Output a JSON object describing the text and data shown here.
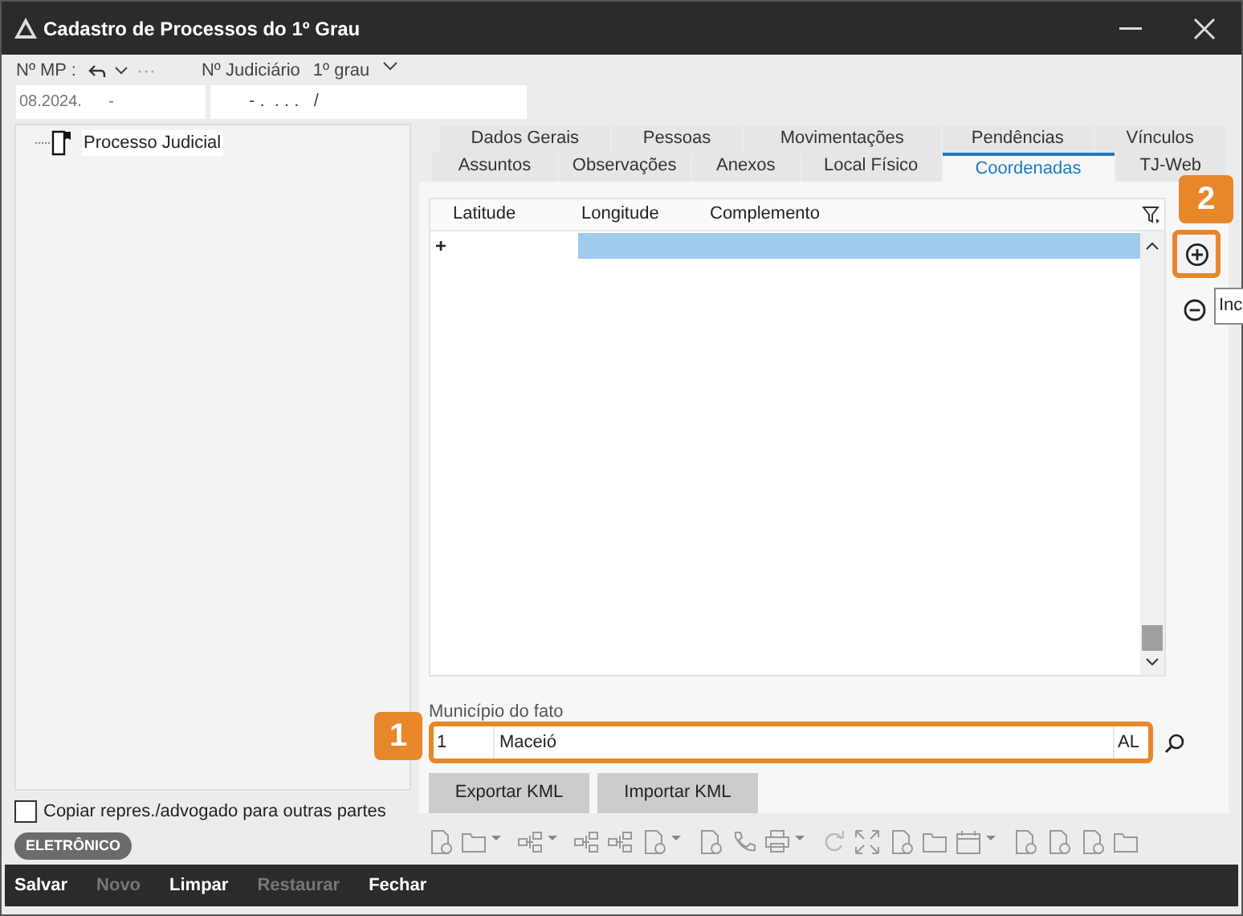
{
  "window": {
    "title": "Cadastro de Processos do 1º Grau"
  },
  "header": {
    "mp_label": "Nº MP :",
    "mp_value": "08.2024.      -",
    "judiciario_label": "Nº Judiciário",
    "grau": "1º grau",
    "judiciario_value": "- .  . . .   /"
  },
  "tree": [
    {
      "label": "Processo Judicial",
      "selected": false
    }
  ],
  "tabs_row_1": [
    {
      "label": "Dados Gerais",
      "selected": false
    },
    {
      "label": "Pessoas",
      "selected": false
    },
    {
      "label": "Movimentações",
      "selected": false
    },
    {
      "label": "Pendências",
      "selected": false
    },
    {
      "label": "Vínculos",
      "selected": false
    }
  ],
  "tabs_row_2": [
    {
      "label": "Assuntos",
      "selected": false
    },
    {
      "label": "Observações",
      "selected": false
    },
    {
      "label": "Anexos",
      "selected": false
    },
    {
      "label": "Local Físico",
      "selected": false
    },
    {
      "label": "Coordenadas",
      "selected": true
    },
    {
      "label": "TJ-Web",
      "selected": false
    }
  ],
  "grid": {
    "columns": [
      "Latitude",
      "Longitude",
      "Complemento"
    ],
    "new_row_marker": "+"
  },
  "tooltip": "Inc",
  "municipio": {
    "label": "Município do fato",
    "code": "1",
    "name": "Maceió",
    "uf": "AL"
  },
  "buttons": [
    "Exportar KML",
    "Importar KML"
  ],
  "callouts": [
    "1",
    "2"
  ],
  "copy_checkbox": {
    "label": "Copiar repres./advogado para outras partes",
    "checked": false
  },
  "badge": "ELETRÔNICO",
  "actions": [
    {
      "label": "Salvar",
      "disabled": false
    },
    {
      "label": "Novo",
      "disabled": true
    },
    {
      "label": "Limpar",
      "disabled": false
    },
    {
      "label": "Restaurar",
      "disabled": true
    },
    {
      "label": "Fechar",
      "disabled": false
    }
  ]
}
